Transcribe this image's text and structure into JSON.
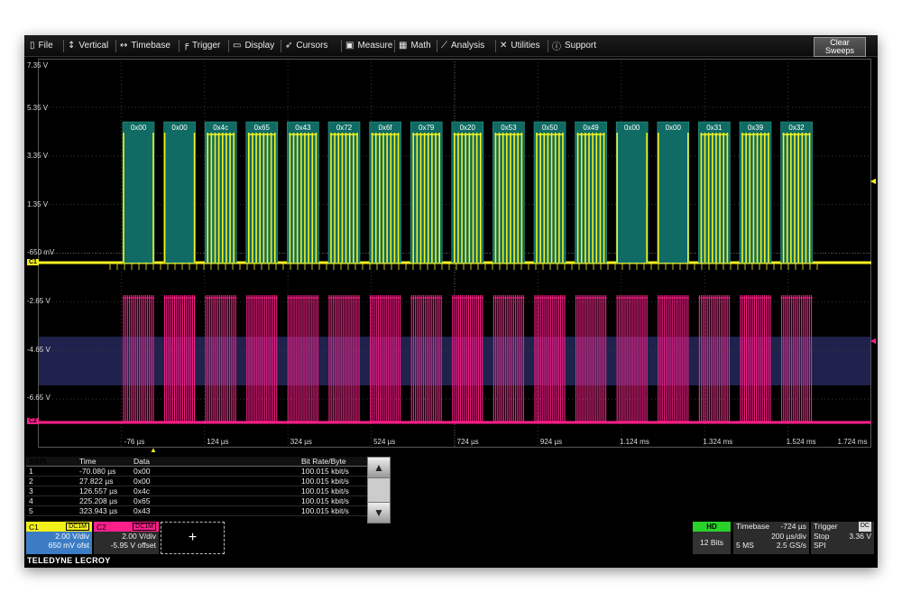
{
  "menu": [
    {
      "label": "File",
      "icon": "file-icon",
      "glyph": "▯"
    },
    {
      "label": "Vertical",
      "icon": "vertical-arrows-icon",
      "glyph": "↕"
    },
    {
      "label": "Timebase",
      "icon": "horizontal-arrows-icon",
      "glyph": "↔"
    },
    {
      "label": "Trigger",
      "icon": "trigger-icon",
      "glyph": "╒"
    },
    {
      "label": "Display",
      "icon": "display-icon",
      "glyph": "▭"
    },
    {
      "label": "Cursors",
      "icon": "cursor-icon",
      "glyph": "➶"
    },
    {
      "label": "Measure",
      "icon": "measure-icon",
      "glyph": "▣"
    },
    {
      "label": "Math",
      "icon": "math-icon",
      "glyph": "▦"
    },
    {
      "label": "Analysis",
      "icon": "analysis-icon",
      "glyph": "⟋"
    },
    {
      "label": "Utilities",
      "icon": "utilities-icon",
      "glyph": "✕"
    },
    {
      "label": "Support",
      "icon": "support-icon",
      "glyph": "ⓘ"
    }
  ],
  "clear_sweeps": {
    "line1": "Clear",
    "line2": "Sweeps"
  },
  "grid": {
    "voltage_labels": [
      "7.35 V",
      "5.35 V",
      "3.35 V",
      "1.35 V",
      "-650 mV",
      "-2.65 V",
      "-4.65 V",
      "-6.65 V"
    ],
    "time_labels": [
      "-76 µs",
      "124 µs",
      "324 µs",
      "524 µs",
      "724 µs",
      "924 µs",
      "1.124 ms",
      "1.324 ms",
      "1.524 ms",
      "1.724 ms"
    ],
    "c1_tag": "C1",
    "c2_tag": "C2",
    "decode_bytes": [
      "0x00",
      "0x00",
      "0x4c",
      "0x65",
      "0x43",
      "0x72",
      "0x6f",
      "0x79",
      "0x20",
      "0x53",
      "0x50",
      "0x49",
      "0x00",
      "0x00",
      "0x31",
      "0x39",
      "0x32"
    ]
  },
  "colors": {
    "c1": "#f5f11f",
    "c2": "#ff1f8a",
    "decode": "#0f6b63",
    "table_tag": "#f2ef1a"
  },
  "table": {
    "name": "SSPI",
    "headers": [
      "Time",
      "Data",
      "Bit Rate/Byte"
    ],
    "rows": [
      {
        "n": "1",
        "time": "-70.080 µs",
        "data": "0x00",
        "rate": "100.015 kbit/s"
      },
      {
        "n": "2",
        "time": "27.822 µs",
        "data": "0x00",
        "rate": "100.015 kbit/s"
      },
      {
        "n": "3",
        "time": "126.557 µs",
        "data": "0x4c",
        "rate": "100.015 kbit/s"
      },
      {
        "n": "4",
        "time": "225.208 µs",
        "data": "0x65",
        "rate": "100.015 kbit/s"
      },
      {
        "n": "5",
        "time": "323.943 µs",
        "data": "0x43",
        "rate": "100.015 kbit/s"
      }
    ]
  },
  "c1": {
    "name": "C1",
    "badge": "DC1M",
    "vdiv": "2.00 V/div",
    "offset": "650 mV ofst"
  },
  "c2": {
    "name": "C2",
    "badge": "DC1M",
    "vdiv": "2.00 V/div",
    "offset": "-5.95 V offset"
  },
  "add_label": "+",
  "hd": {
    "label": "HD",
    "bits": "12 Bits"
  },
  "timebase": {
    "label": "Timebase",
    "delay": "-724 µs",
    "tdiv": "200 µs/div",
    "memory": "5 MS",
    "rate": "2.5 GS/s"
  },
  "trigger": {
    "label": "Trigger",
    "coupling": "DC",
    "mode": "Stop",
    "level": "3.36 V",
    "type": "SPI"
  },
  "brand": "TELEDYNE LECROY"
}
